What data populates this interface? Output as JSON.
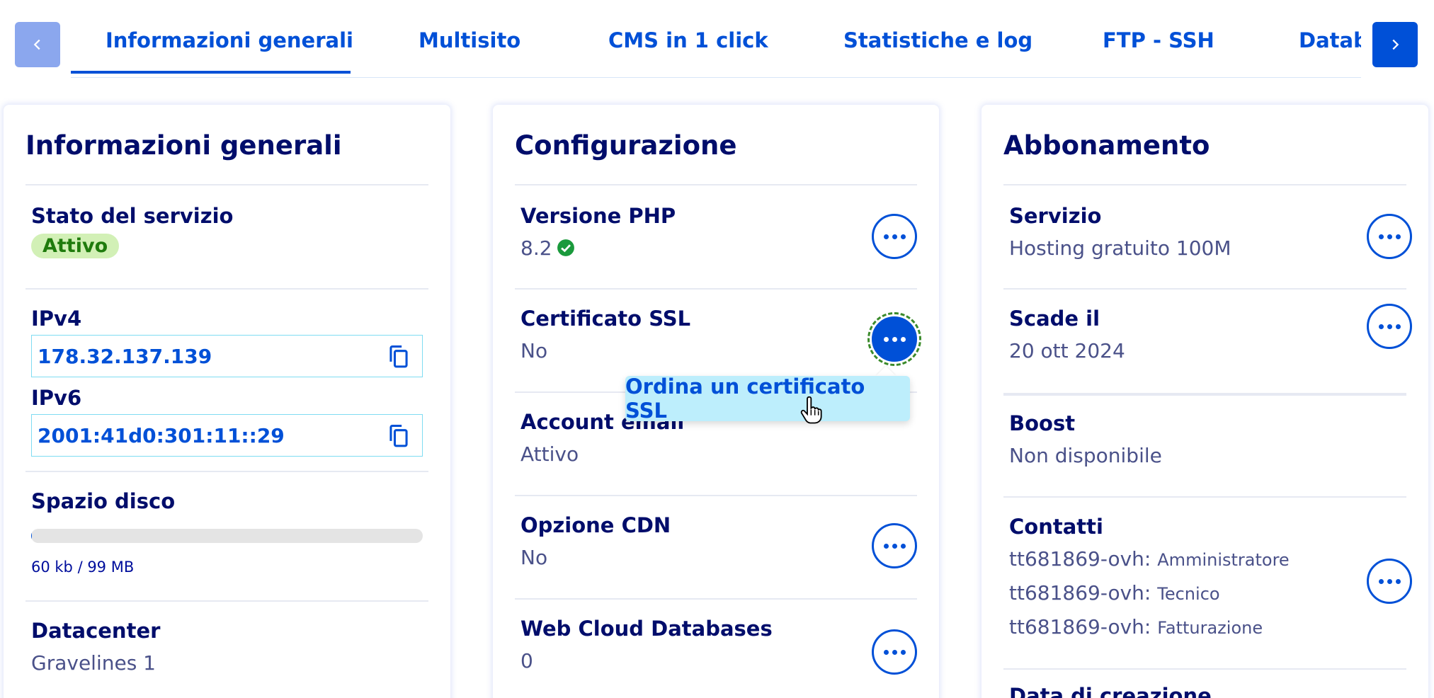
{
  "tabs": {
    "items": [
      {
        "label": "Informazioni generali"
      },
      {
        "label": "Multisito"
      },
      {
        "label": "CMS in 1 click"
      },
      {
        "label": "Statistiche e log"
      },
      {
        "label": "FTP - SSH"
      },
      {
        "label": "Database"
      }
    ],
    "active_index": 0
  },
  "general": {
    "title": "Informazioni generali",
    "service_state_label": "Stato del servizio",
    "service_state_value": "Attivo",
    "ipv4_label": "IPv4",
    "ipv4_value": "178.32.137.139",
    "ipv6_label": "IPv6",
    "ipv6_value": "2001:41d0:301:11::29",
    "disk_label": "Spazio disco",
    "disk_text": "60 kb / 99 MB",
    "disk_usage_fraction": 0.0006,
    "datacenter_label": "Datacenter",
    "datacenter_value": "Gravelines 1"
  },
  "config": {
    "title": "Configurazione",
    "php_label": "Versione PHP",
    "php_value": "8.2",
    "ssl_label": "Certificato SSL",
    "ssl_value": "No",
    "email_label": "Account email",
    "email_value": "Attivo",
    "cdn_label": "Opzione CDN",
    "cdn_value": "No",
    "webcloud_label": "Web Cloud Databases",
    "webcloud_value": "0",
    "tooltip": "Ordina un certificato SSL"
  },
  "subscription": {
    "title": "Abbonamento",
    "service_label": "Servizio",
    "service_value": "Hosting gratuito 100M",
    "expiry_label": "Scade il",
    "expiry_value": "20 ott 2024",
    "boost_label": "Boost",
    "boost_value": "Non disponibile",
    "contacts_label": "Contatti",
    "contacts": [
      {
        "account": "tt681869-ovh:",
        "role": "Amministratore"
      },
      {
        "account": "tt681869-ovh:",
        "role": "Tecnico"
      },
      {
        "account": "tt681869-ovh:",
        "role": "Fatturazione"
      }
    ],
    "creation_label": "Data di creazione"
  },
  "colors": {
    "primary": "#0050d7",
    "heading": "#000d6b",
    "success_bg": "#d2f0b6",
    "success_text": "#1f7b0d",
    "tooltip_bg": "#bdeefc"
  },
  "icons": {
    "prev": "chevron-left-icon",
    "next": "chevron-right-icon",
    "copy": "copy-icon",
    "more": "more-horizontal-icon",
    "check": "check-circle-icon",
    "cursor": "hand-pointer-icon"
  }
}
